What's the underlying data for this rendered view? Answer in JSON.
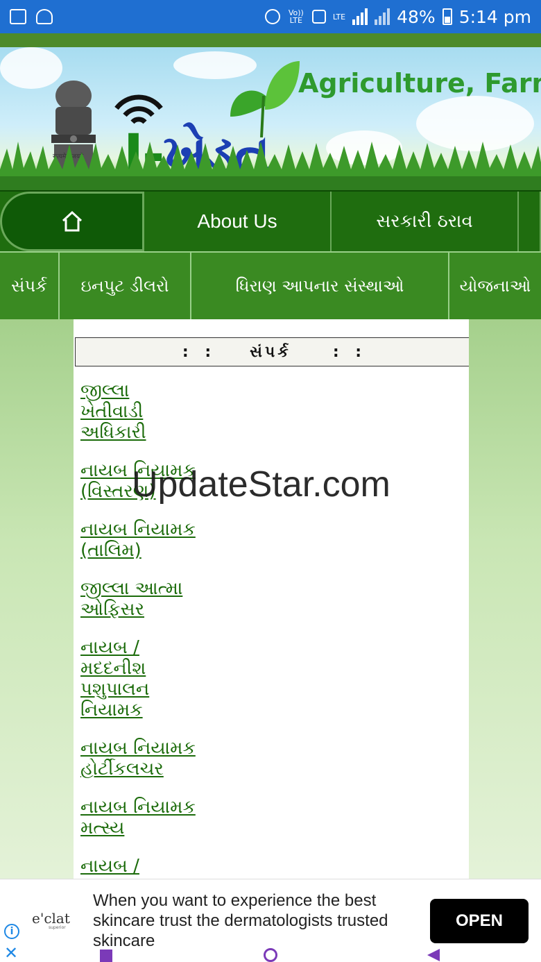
{
  "status_bar": {
    "volte": "Vo)) LTE",
    "lte": "LTE",
    "battery": "48%",
    "time": "5:14 pm"
  },
  "header": {
    "logo_i": "I-",
    "logo_text": "ખેડૂત",
    "tagline": "Agriculture, Farme",
    "emblem_motto": "सत्यमेव जयते"
  },
  "nav_primary": {
    "home_icon": "home-icon",
    "about": "About Us",
    "government": "સરકારી ઠરાવ"
  },
  "nav_secondary": {
    "items": [
      "સંપર્ક",
      "ઇનપુટ ડીલરો",
      "ધિરાણ આપનાર સંસ્થાઓ",
      "યોજનાઓ"
    ]
  },
  "panel": {
    "title_prefix": ":  :",
    "title": "સંપર્ક",
    "title_suffix": ":  :",
    "links": [
      "જીલ્લા ખેતીવાડી અધિકારી",
      "નાયબ નિયામક (વિસ્તરણ)",
      "નાયબ નિયામક (તાલિમ)",
      "જીલ્લા આત્મા ઓફિસર",
      "નાયબ / મદદનીશ પશુપાલન નિયામક",
      "નાયબ નિયામક હોર્ટીકલચર",
      "નાયબ નિયામક મત્સ્ય",
      "નાયબ /"
    ]
  },
  "watermark": "UpdateStar.com",
  "ad": {
    "brand": "e'clat",
    "brand_sub": "superior",
    "text": "When you want to experience the best skincare trust the dermatologists trusted skincare",
    "button": "OPEN",
    "info": "i",
    "close": "✕"
  }
}
